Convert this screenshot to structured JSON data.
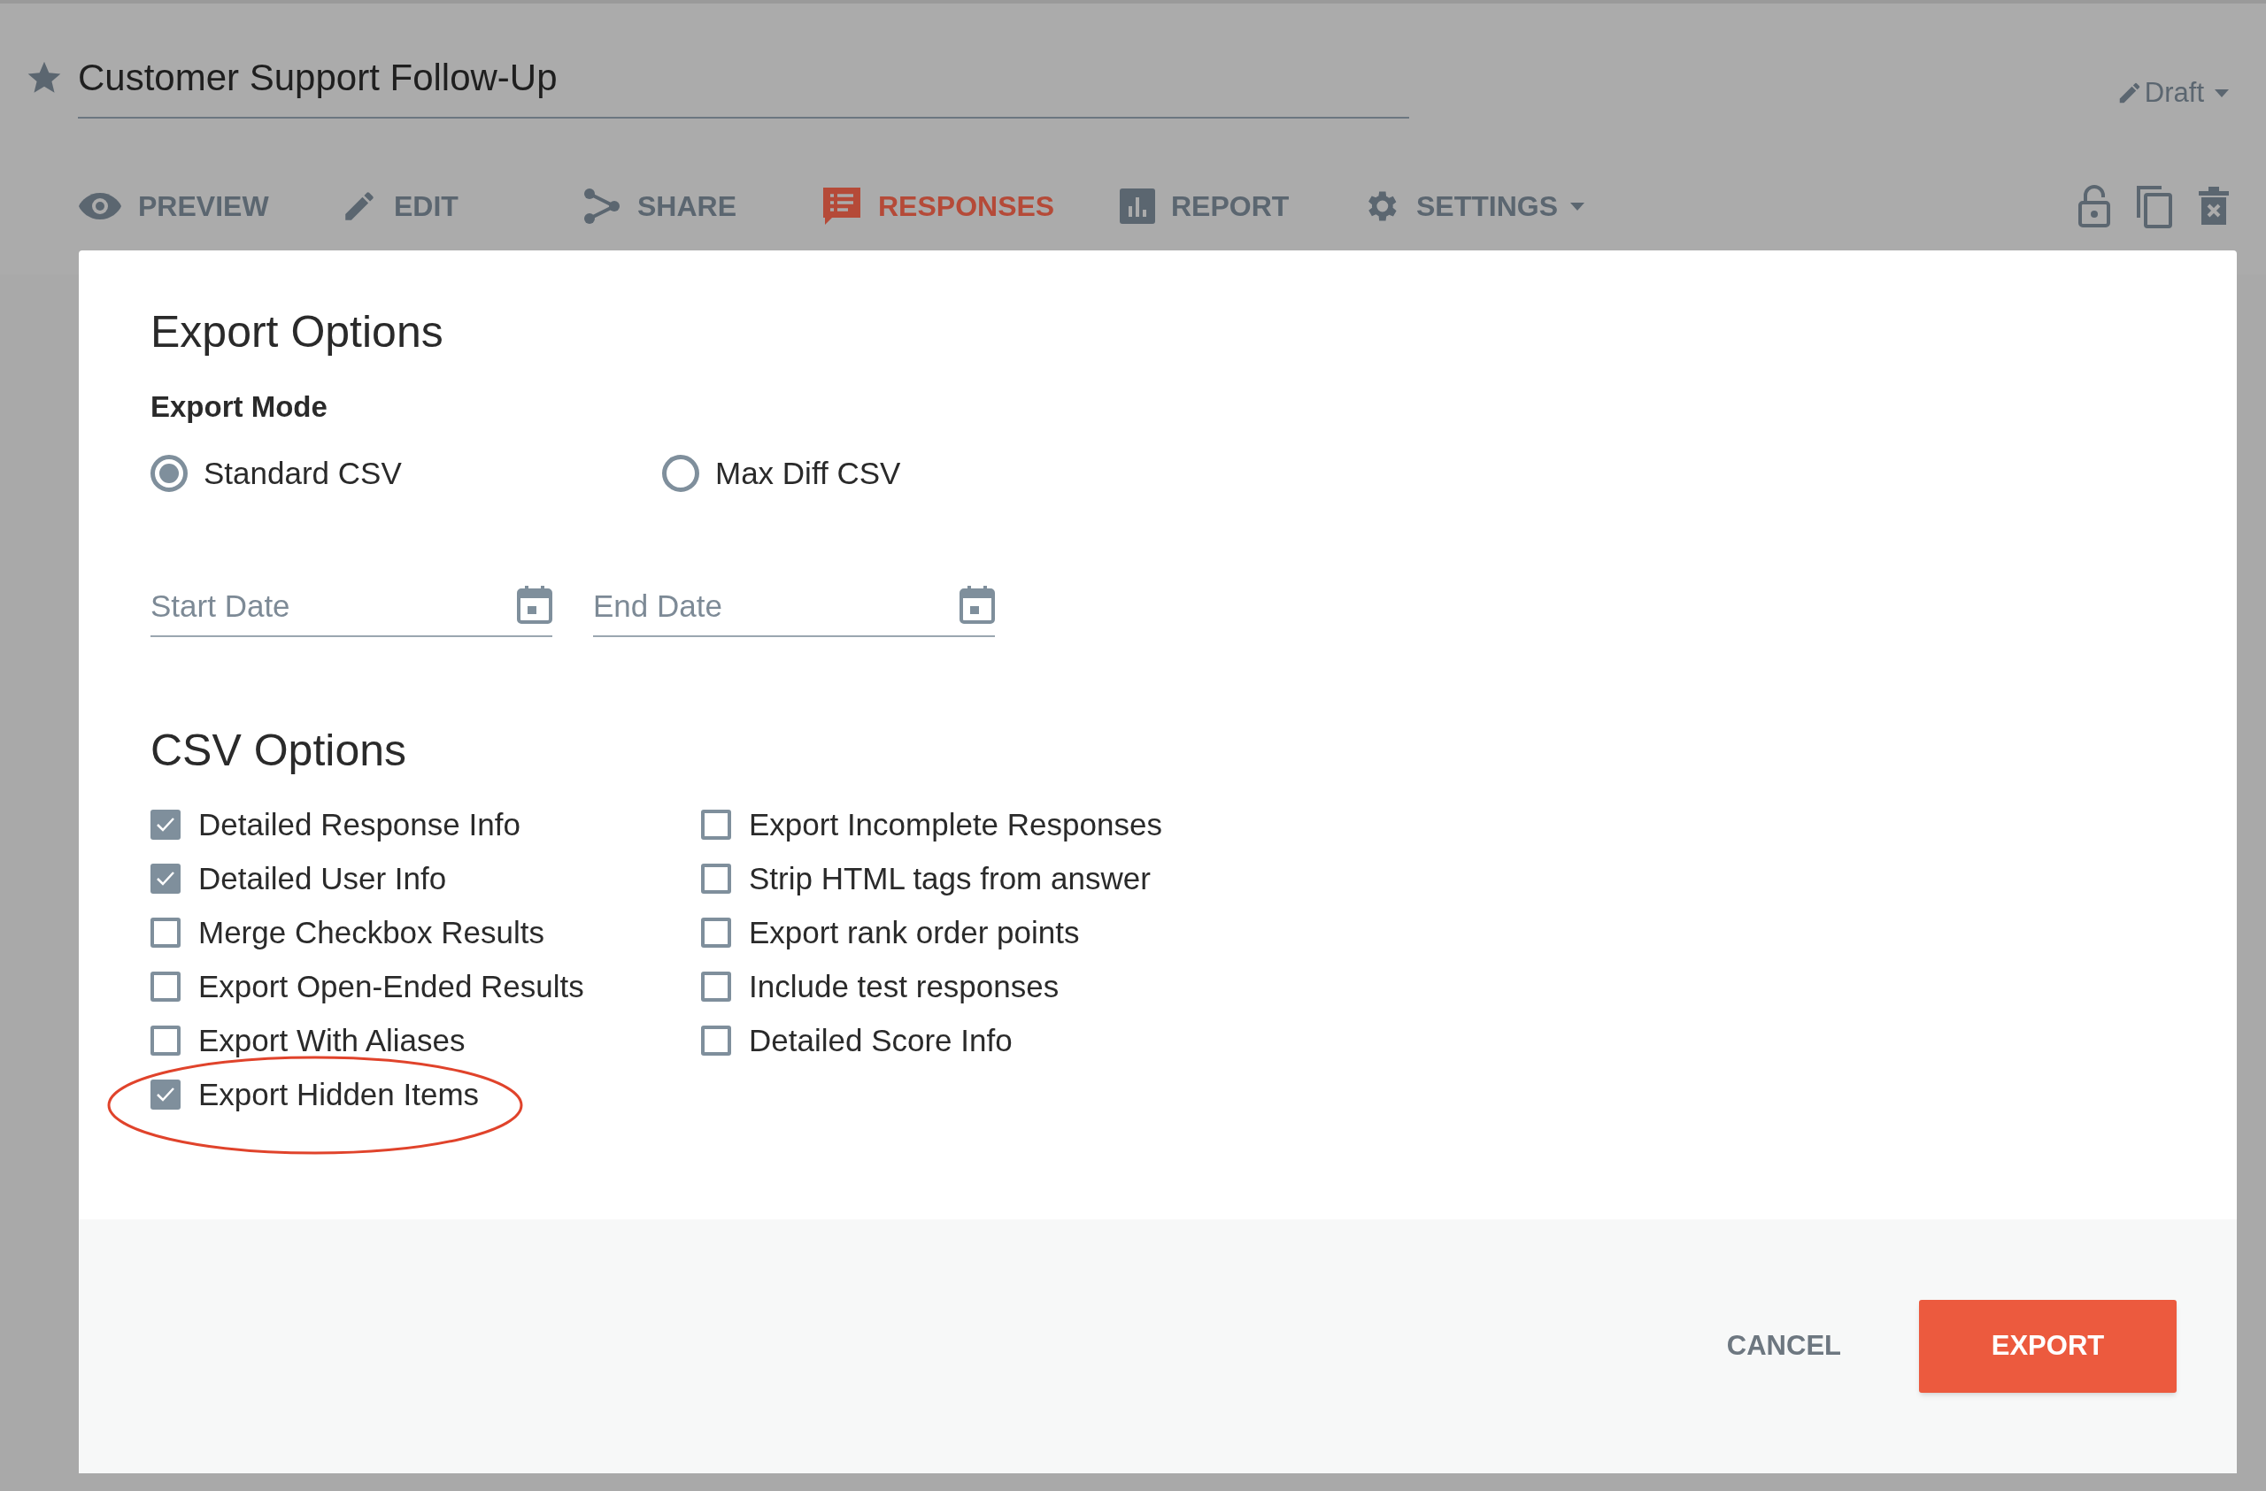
{
  "header": {
    "title": "Customer Support Follow-Up",
    "status": "Draft"
  },
  "nav": [
    {
      "label": "PREVIEW",
      "selected": false,
      "dropdown": false
    },
    {
      "label": "EDIT",
      "selected": false,
      "dropdown": false
    },
    {
      "label": "SHARE",
      "selected": false,
      "dropdown": false
    },
    {
      "label": "RESPONSES",
      "selected": true,
      "dropdown": false
    },
    {
      "label": "REPORT",
      "selected": false,
      "dropdown": false
    },
    {
      "label": "SETTINGS",
      "selected": false,
      "dropdown": true
    }
  ],
  "modal": {
    "title": "Export Options",
    "export_mode": {
      "label": "Export Mode",
      "options": [
        {
          "label": "Standard CSV",
          "selected": true
        },
        {
          "label": "Max Diff CSV",
          "selected": false
        }
      ]
    },
    "date_fields": [
      {
        "placeholder": "Start Date"
      },
      {
        "placeholder": "End Date"
      }
    ],
    "csv_options": {
      "title": "CSV Options",
      "columns": [
        [
          {
            "label": "Detailed Response Info",
            "checked": true,
            "circled": false
          },
          {
            "label": "Detailed User Info",
            "checked": true,
            "circled": false
          },
          {
            "label": "Merge Checkbox Results",
            "checked": false,
            "circled": false
          },
          {
            "label": "Export Open-Ended Results",
            "checked": false,
            "circled": false
          },
          {
            "label": "Export With Aliases",
            "checked": false,
            "circled": false
          },
          {
            "label": "Export Hidden Items",
            "checked": true,
            "circled": true
          }
        ],
        [
          {
            "label": "Export Incomplete Responses",
            "checked": false,
            "circled": false
          },
          {
            "label": "Strip HTML tags from answer",
            "checked": false,
            "circled": false
          },
          {
            "label": "Export rank order points",
            "checked": false,
            "circled": false
          },
          {
            "label": "Include test responses",
            "checked": false,
            "circled": false
          },
          {
            "label": "Detailed Score Info",
            "checked": false,
            "circled": false
          }
        ]
      ]
    },
    "buttons": [
      {
        "label": "CANCEL",
        "kind": "secondary"
      },
      {
        "label": "EXPORT",
        "kind": "primary"
      }
    ]
  }
}
